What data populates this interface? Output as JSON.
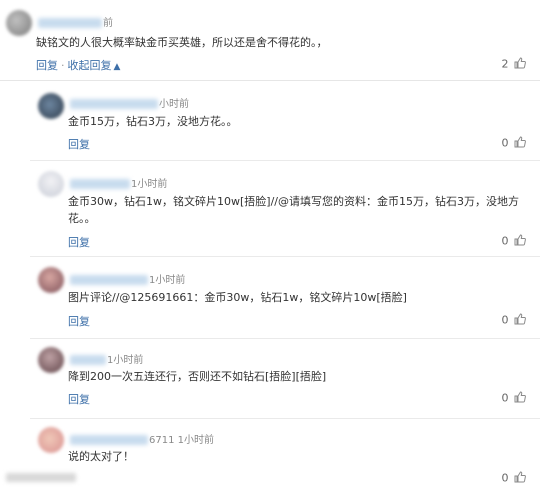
{
  "top_comment": {
    "time": "前",
    "text": "缺铭文的人很大概率缺金币买英雄，所以还是舍不得花的。，",
    "reply_label": "回复",
    "collapse_label": "收起回复",
    "likes": "2"
  },
  "replies": [
    {
      "name_suffix": "",
      "time": "小时前",
      "text": "金币15万，钻石3万，没地方花。。",
      "reply_label": "回复",
      "likes": "0"
    },
    {
      "name_suffix": "",
      "time": "1小时前",
      "text_line1": "金币30w，钻石1w，铭文碎片10w[捂脸]//@请填写您的资料：金币15万，钻石3万，没地方",
      "text_line2": "花。。",
      "reply_label": "回复",
      "likes": "0"
    },
    {
      "name_suffix": "",
      "time": "1小时前",
      "text": "图片评论//@125691661：金币30w，钻石1w，铭文碎片10w[捂脸]",
      "reply_label": "回复",
      "likes": "0"
    },
    {
      "name_suffix": "",
      "time": "1小时前",
      "text": "降到200一次五连还行，否则还不如钻石[捂脸][捂脸]",
      "reply_label": "回复",
      "likes": "0"
    },
    {
      "name_suffix": "6711",
      "time": "1小时前",
      "text": "说的太对了！",
      "reply_label": "回复",
      "likes": "0"
    }
  ],
  "icons": {
    "thumb": "thumb-up-icon",
    "collapse": "chevron-up-icon"
  },
  "colors": {
    "link": "#3d6fa8",
    "text": "#333333",
    "meta": "#888888"
  }
}
